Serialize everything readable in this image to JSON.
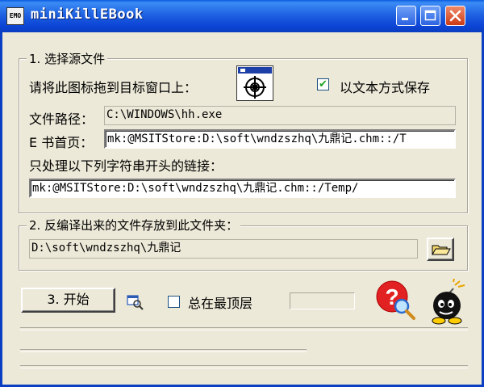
{
  "window": {
    "title": "miniKillEBook",
    "icon_text": "EMO"
  },
  "section1": {
    "title": "1. 选择源文件",
    "drag_label": "请将此图标拖到目标窗口上：",
    "save_as_text_label": "以文本方式保存",
    "save_as_text_checked": true,
    "file_path_label": "文件路径：",
    "file_path_value": "C:\\WINDOWS\\hh.exe",
    "ebook_home_label": "E 书首页：",
    "ebook_home_value": "mk:@MSITStore:D:\\soft\\wndzszhq\\九鼎记.chm::/T",
    "prefix_label": "只处理以下列字符串开头的链接：",
    "prefix_value": "mk:@MSITStore:D:\\soft\\wndzszhq\\九鼎记.chm::/Temp/"
  },
  "section2": {
    "title": "2. 反编译出来的文件存放到此文件夹：",
    "folder_value": "D:\\soft\\wndzszhq\\九鼎记"
  },
  "bottom": {
    "start_label": "3. 开始",
    "always_on_top_label": "总在最顶层",
    "always_on_top_checked": false
  },
  "icons": {
    "crosshair": "crosshair-target-icon",
    "folder": "open-folder-icon",
    "help": "help-magnifier-icon",
    "bomb": "bomb-icon",
    "locate": "locate-window-icon"
  }
}
